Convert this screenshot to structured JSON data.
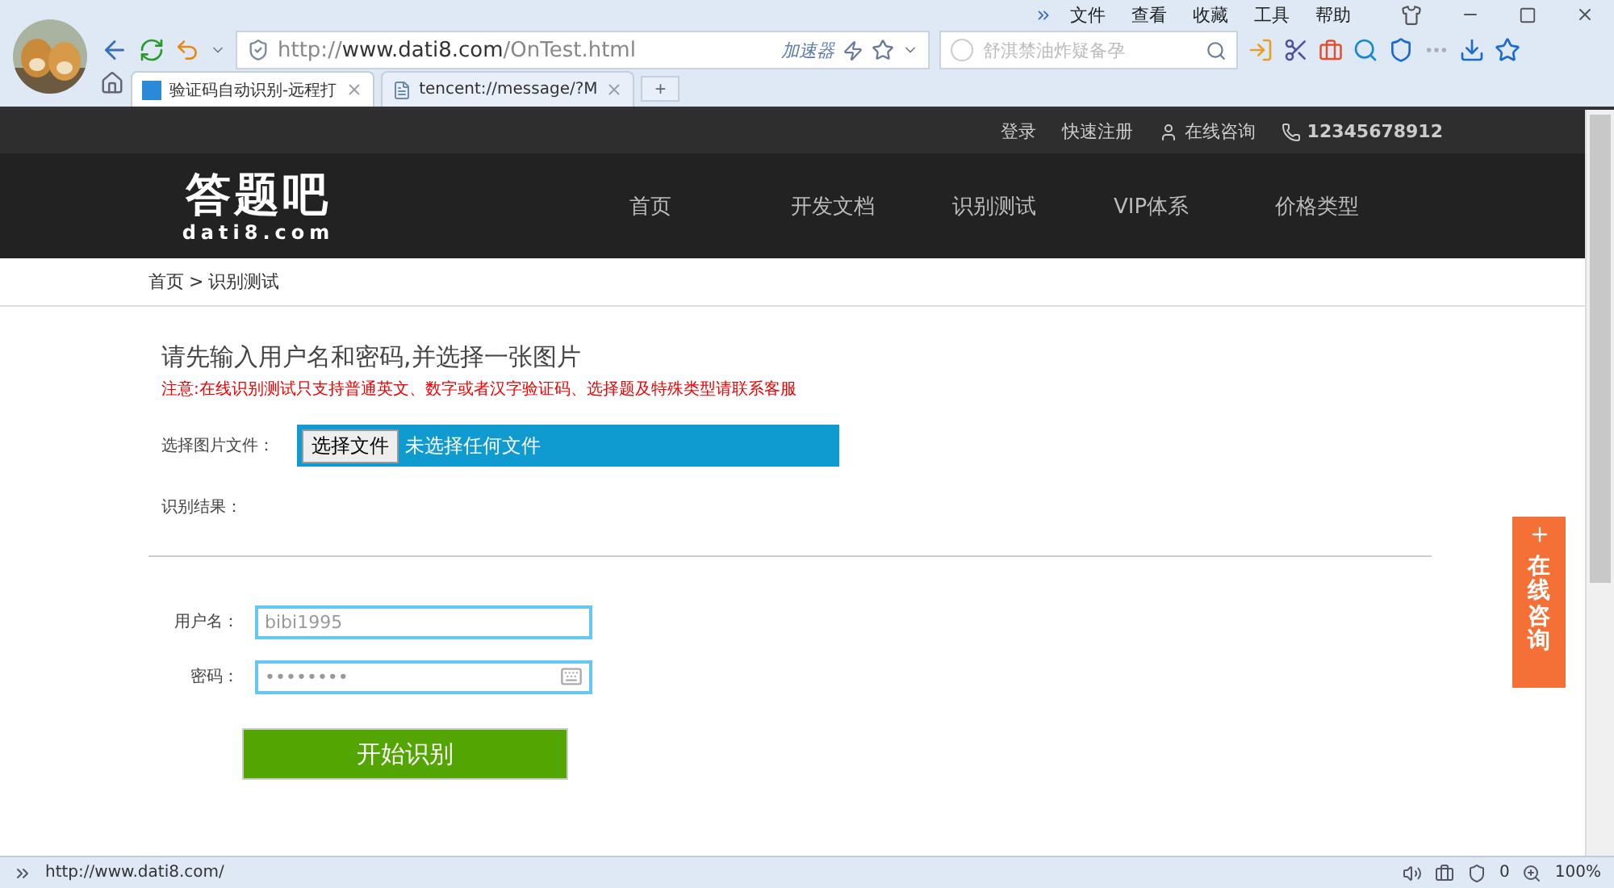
{
  "browser": {
    "menu": [
      "文件",
      "查看",
      "收藏",
      "工具",
      "帮助"
    ],
    "address": {
      "prefix": "http://",
      "domain": "www.dati8.com",
      "path": "/OnTest.html"
    },
    "accelerator": "加速器",
    "search": {
      "placeholder": "舒淇禁油炸疑备孕"
    },
    "tabs": [
      {
        "label": "验证码自动识别-远程打",
        "selected": true
      },
      {
        "label": "tencent://message/?M",
        "selected": false
      }
    ],
    "new_tab": "+"
  },
  "topbar": {
    "links": [
      "登录",
      "快速注册"
    ],
    "consult": "在线咨询",
    "phone": "12345678912"
  },
  "header": {
    "logo": "答题吧",
    "logo_sub": "dati8.com",
    "nav": [
      "首页",
      "开发文档",
      "识别测试",
      "VIP体系",
      "价格类型"
    ]
  },
  "breadcrumb": {
    "home": "首页",
    "sep": ">",
    "current": "识别测试"
  },
  "form": {
    "title": "请先输入用户名和密码,并选择一张图片",
    "notice": "注意:在线识别测试只支持普通英文、数字或者汉字验证码、选择题及特殊类型请联系客服",
    "file_label": "选择图片文件：",
    "file_button": "选择文件",
    "file_status": "未选择任何文件",
    "result_label": "识别结果：",
    "username_label": "用户名：",
    "username": "bibi1995",
    "password_label": "密码：",
    "password": "••••••••",
    "submit": "开始识别"
  },
  "float_tab": "在线咨询",
  "status_bar": {
    "url": "http://www.dati8.com/",
    "count": "0",
    "zoom": "100%"
  }
}
